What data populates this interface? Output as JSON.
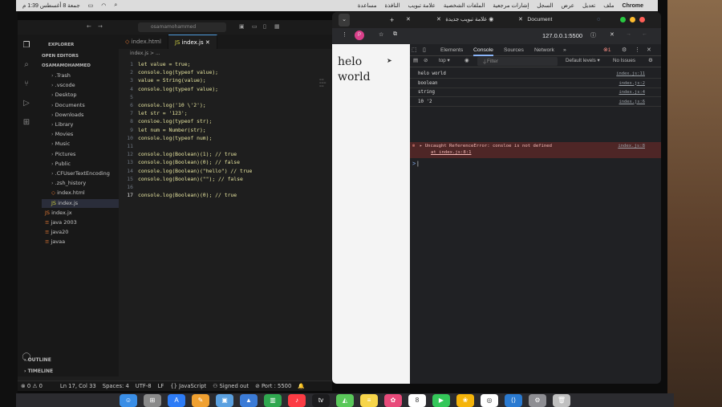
{
  "menubar": {
    "time": "جمعة 8 أغسطس 1:39 م",
    "app": "Chrome",
    "items": [
      "ملف",
      "تعديل",
      "عرض",
      "السجل",
      "إشارات مرجعية",
      "الملفات الشخصية",
      "علامة تبويب",
      "النافذة",
      "مساعدة"
    ]
  },
  "vscode": {
    "search_placeholder": "osamamohammed",
    "tabs": [
      {
        "label": "index.html"
      },
      {
        "label": "index.js"
      }
    ],
    "breadcrumb": "index.js > ...",
    "explorer_title": "EXPLORER",
    "open_editors": "OPEN EDITORS",
    "root": "OSAMAMOHAMMED",
    "tree": [
      ".Trash",
      ".vscode",
      "Desktop",
      "Documents",
      "Downloads",
      "Library",
      "Movies",
      "Music",
      "Pictures",
      "Public",
      ".CFUserTextEncoding",
      ".zsh_history",
      "index.html",
      "index.js",
      "index.jx",
      "java 2003",
      "java20",
      "javaa"
    ],
    "outline": "OUTLINE",
    "timeline": "TIMELINE",
    "code": [
      {
        "n": "1",
        "t": "let value = true;"
      },
      {
        "n": "2",
        "t": "console.log(typeof value);"
      },
      {
        "n": "3",
        "t": "value = String(value);"
      },
      {
        "n": "4",
        "t": "console.log(typeof value);"
      },
      {
        "n": "5",
        "t": ""
      },
      {
        "n": "6",
        "t": "console.log('10 \\'2');"
      },
      {
        "n": "7",
        "t": "let str = '123';"
      },
      {
        "n": "8",
        "t": "consloe.log(typeof str);"
      },
      {
        "n": "9",
        "t": "let num = Number(str);"
      },
      {
        "n": "10",
        "t": "console.log(typeof num);"
      },
      {
        "n": "11",
        "t": ""
      },
      {
        "n": "12",
        "t": "console.log(Boolean)(1); // true"
      },
      {
        "n": "13",
        "t": "console.log(Boolean)(0); // false"
      },
      {
        "n": "14",
        "t": "console.log(Boolean)(\"hello\") // true"
      },
      {
        "n": "15",
        "t": "console.log(Boolean)(\"\"); // false"
      },
      {
        "n": "16",
        "t": ""
      },
      {
        "n": "17",
        "t": "console.log(Boolean)(0); // true"
      }
    ],
    "status": {
      "errors": "⊗ 0 ⚠ 0",
      "position": "Ln 17, Col 33",
      "spaces": "Spaces: 4",
      "encoding": "UTF-8",
      "eol": "LF",
      "language": "{} JavaScript",
      "account": "Signed out",
      "port": "Port : 5500"
    }
  },
  "chrome": {
    "tabs": [
      {
        "label": "علامة تبويب جديدة"
      },
      {
        "label": "Document"
      }
    ],
    "url": "127.0.0.1:5500",
    "page_lines": [
      "helo",
      "world"
    ],
    "devtools": {
      "tabs": [
        "Elements",
        "Console",
        "Sources",
        "Network"
      ],
      "active_tab": "Console",
      "context": "top",
      "filter_placeholder": "Filter",
      "levels": "Default levels",
      "issues": "No Issues",
      "error_count": "1",
      "logs": [
        {
          "msg": "helo world",
          "src": "index.js:11"
        },
        {
          "msg": "boolean",
          "src": "index.js:2"
        },
        {
          "msg": "string",
          "src": "index.js:4"
        },
        {
          "msg": "10 '2",
          "src": "index.js:6"
        }
      ],
      "error": {
        "msg": "Uncaught ReferenceError: consloe is not defined",
        "at": "at index.js:8:1",
        "src": "index.js:8"
      },
      "prompt": ">"
    }
  },
  "dock": {
    "apps": [
      "finder-icon",
      "launchpad-icon",
      "appstore-icon",
      "pages-icon",
      "preview-icon",
      "keynote-icon",
      "numbers-icon",
      "music-icon",
      "tv-icon",
      "maps-icon",
      "notes-icon",
      "photos-icon",
      "calendar-icon",
      "facetime-icon",
      "photos-app-icon",
      "chrome-icon",
      "vscode-icon",
      "settings-icon",
      "trash-icon"
    ]
  }
}
